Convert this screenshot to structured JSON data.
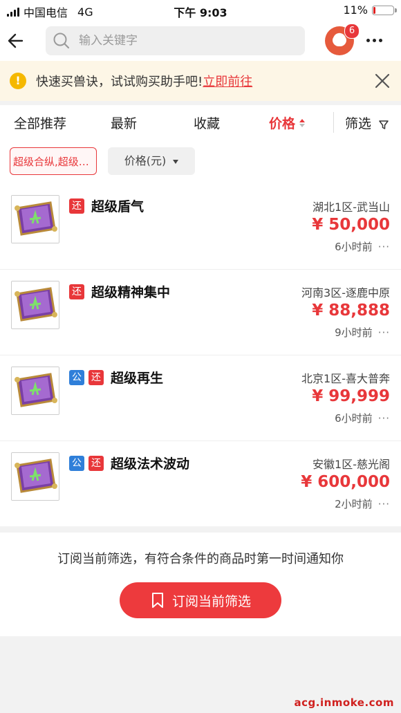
{
  "status_bar": {
    "carrier": "中国电信",
    "network": "4G",
    "time": "下午 9:03",
    "battery": "11%",
    "battery_level": 0.11
  },
  "search": {
    "placeholder": "输入关键字"
  },
  "header": {
    "avatar_badge": "6"
  },
  "banner": {
    "text": "快速买兽诀，试试购买助手吧!",
    "link": "立即前往"
  },
  "tabs": [
    {
      "label": "全部推荐"
    },
    {
      "label": "最新"
    },
    {
      "label": "收藏"
    },
    {
      "label": "价格"
    },
    {
      "label": "筛选"
    }
  ],
  "filters": {
    "chip_selected": "超级合纵,超级…",
    "chip_price": "价格(元)"
  },
  "items": [
    {
      "name": "超级盾气",
      "tag_gong": "",
      "tag_huan": "还",
      "server": "湖北1区-武当山",
      "price": "¥ 50,000",
      "time": "6小时前"
    },
    {
      "name": "超级精神集中",
      "tag_gong": "",
      "tag_huan": "还",
      "server": "河南3区-逐鹿中原",
      "price": "¥ 88,888",
      "time": "9小时前"
    },
    {
      "name": "超级再生",
      "tag_gong": "公",
      "tag_huan": "还",
      "server": "北京1区-喜大普奔",
      "price": "¥ 99,999",
      "time": "6小时前"
    },
    {
      "name": "超级法术波动",
      "tag_gong": "公",
      "tag_huan": "还",
      "server": "安徽1区-慈光阁",
      "price": "¥ 600,000",
      "time": "2小时前"
    }
  ],
  "subscribe": {
    "message": "订阅当前筛选，有符合条件的商品时第一时间通知你",
    "button": "订阅当前筛选"
  },
  "watermark": "acg.inmoke.com",
  "colors": {
    "accent": "#e8373a",
    "banner_bg": "#fdf6e6",
    "gong_tag": "#2f7fd9"
  }
}
